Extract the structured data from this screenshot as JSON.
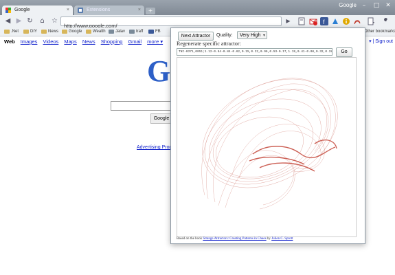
{
  "window": {
    "title": "Google",
    "min": "–",
    "max": "□",
    "close": "✕"
  },
  "tabs": [
    {
      "label": "Google",
      "active": true,
      "close": "×"
    },
    {
      "label": "Extensions",
      "active": false,
      "close": "×"
    }
  ],
  "new_tab": "+",
  "toolbar": {
    "back": "◀",
    "forward": "▶",
    "reload": "↻",
    "home": "⌂",
    "star": "☆",
    "url": "http://www.google.com/",
    "go": "▶"
  },
  "bookmarks": [
    {
      "label": ".Net",
      "folder": true
    },
    {
      "label": "DIY",
      "folder": true
    },
    {
      "label": "News",
      "folder": true
    },
    {
      "label": "Google",
      "folder": true
    },
    {
      "label": "Wealth",
      "folder": true
    },
    {
      "label": "Jalav",
      "folder": false
    },
    {
      "label": "traff",
      "folder": false
    },
    {
      "label": "FB",
      "folder": false
    }
  ],
  "other_bookmarks": "Other bookmarks",
  "google": {
    "nav": [
      "Web",
      "Images",
      "Videos",
      "Maps",
      "News",
      "Shopping",
      "Gmail",
      "more ▾"
    ],
    "signout": "▾ | Sign out",
    "logo": "G",
    "button": "Google",
    "advertising": "Advertising Prog"
  },
  "popup": {
    "next_button": "Next Attractor",
    "quality_label": "Quality:",
    "quality_value": "Very High",
    "regen_label": "Regenerate specific attractor:",
    "code": "TNI-0371,0051;1.12-0.64-0.84-0.62,0.15,0.22,0.96,0.53-0.17,1.19,0.41-0.08,0.32,0.28,0.96,0.57,1.06-0.18,1.10,0.87-0.76,0.72,0.58-0.66,0.74",
    "go_label": "Go",
    "footer_prefix": "Based on the book",
    "footer_book": "Strange Attractors: Creating Patterns in Chaos",
    "footer_by": "by",
    "footer_author": "Julien C. Sprott"
  },
  "colors": {
    "accent": "#c0392b",
    "link": "#1122cc",
    "chrome": "#eef1f4"
  }
}
